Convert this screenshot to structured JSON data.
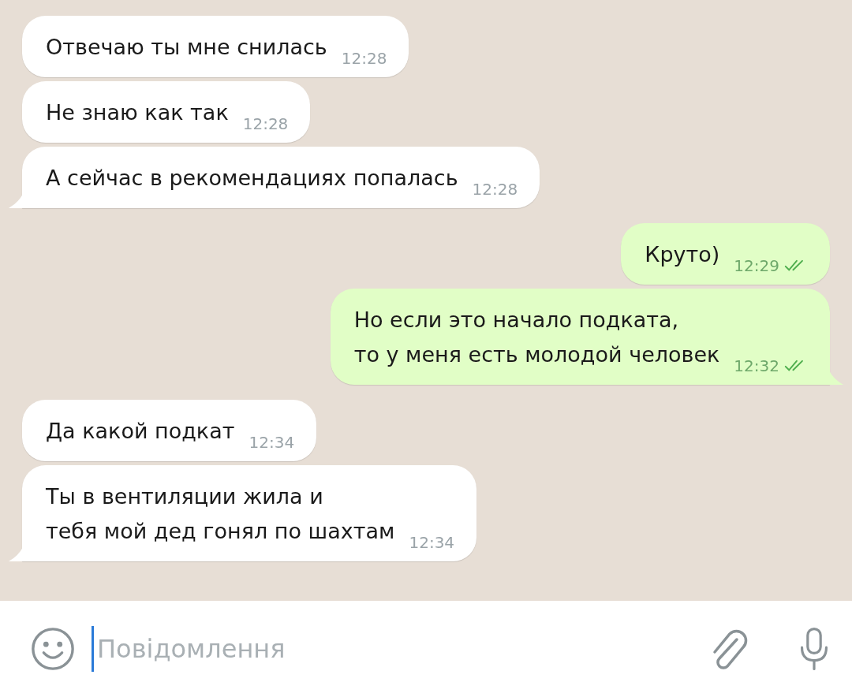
{
  "messages": [
    {
      "kind": "incoming",
      "text": "Отвечаю ты мне снилась",
      "time": "12:28",
      "tail": false
    },
    {
      "kind": "incoming",
      "text": "Не знаю как так",
      "time": "12:28",
      "tail": false
    },
    {
      "kind": "incoming",
      "text": "А сейчас в рекомендациях попалась",
      "time": "12:28",
      "tail": true
    },
    {
      "kind": "outgoing",
      "text": "Круто)",
      "time": "12:29",
      "tail": false,
      "read": true
    },
    {
      "kind": "outgoing",
      "text": "Но если это начало подката,\nто у меня есть молодой человек",
      "time": "12:32",
      "tail": true,
      "read": true
    },
    {
      "kind": "incoming",
      "text": "Да какой подкат",
      "time": "12:34",
      "tail": false
    },
    {
      "kind": "incoming",
      "text": "Ты в вентиляции жила и\nтебя мой дед гонял по шахтам",
      "time": "12:34",
      "tail": true
    }
  ],
  "composer": {
    "placeholder": "Повідомлення"
  }
}
